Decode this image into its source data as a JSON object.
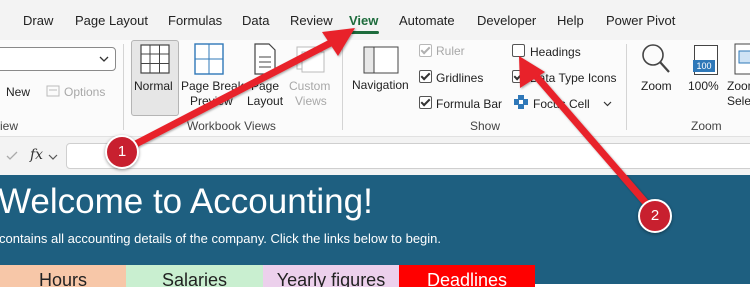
{
  "menu": {
    "items": [
      "Draw",
      "Page Layout",
      "Formulas",
      "Data",
      "Review",
      "View",
      "Automate",
      "Developer",
      "Help",
      "Power Pivot"
    ],
    "active": "View"
  },
  "ribbon": {
    "left_partial": {
      "new_label": "New",
      "options_label": "Options",
      "group_label": "iew"
    },
    "workbook_views": {
      "normal": "Normal",
      "page_break_preview": [
        "Page Break",
        "Preview"
      ],
      "page_layout": [
        "Page",
        "Layout"
      ],
      "custom_views": [
        "Custom",
        "Views"
      ],
      "group_label": "Workbook Views"
    },
    "show": {
      "navigation": "Navigation",
      "ruler": "Ruler",
      "gridlines": "Gridlines",
      "formula_bar": "Formula Bar",
      "headings": "Headings",
      "data_type_icons": "Data Type Icons",
      "focus_cell": "Focus Cell",
      "group_label": "Show",
      "checked": {
        "ruler": true,
        "gridlines": true,
        "formula_bar": true,
        "headings": false,
        "data_type_icons": true
      }
    },
    "zoom": {
      "zoom": "Zoom",
      "hundred": "100%",
      "icon_badge": "100",
      "zoom_to_selection": [
        "Zoom",
        "Selec"
      ],
      "group_label": "Zoom"
    }
  },
  "formula_bar": {
    "fx": "fx",
    "value": ""
  },
  "sheet": {
    "title": "Welcome to Accounting!",
    "subtitle": "contains all accounting details of the company. Click the links below to begin.",
    "buttons": [
      {
        "label": "Hours",
        "color": "#f7c7a8"
      },
      {
        "label": "Salaries",
        "color": "#c9efd0"
      },
      {
        "label": "Yearly figures",
        "color": "#ecd0ec"
      },
      {
        "label": "Deadlines",
        "color": "#ff0000"
      }
    ],
    "background": "#1e5f80"
  },
  "annotations": {
    "badge1": "1",
    "badge2": "2",
    "arrow_color": "#e8202a"
  }
}
